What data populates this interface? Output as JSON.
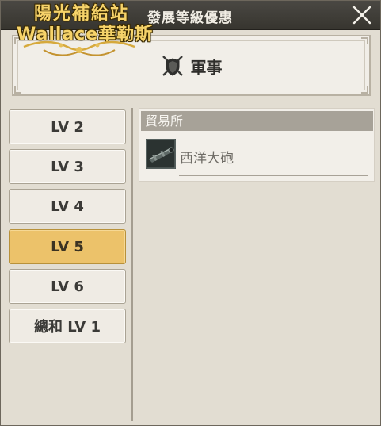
{
  "window": {
    "title": "發展等級優惠"
  },
  "watermark": {
    "line1": "陽光補給站",
    "line2": "Wallace華勒斯"
  },
  "header": {
    "category_label": "軍事",
    "category_icon": "crossed-swords-shield-icon"
  },
  "levels": [
    {
      "label": "LV 2",
      "active": false
    },
    {
      "label": "LV 3",
      "active": false
    },
    {
      "label": "LV 4",
      "active": false
    },
    {
      "label": "LV 5",
      "active": true
    },
    {
      "label": "LV 6",
      "active": false
    },
    {
      "label": "總和 LV 1",
      "active": false
    }
  ],
  "content": {
    "section_title": "貿易所",
    "items": [
      {
        "name": "西洋大砲",
        "icon": "cannon-icon"
      }
    ]
  },
  "colors": {
    "active_level": "#ecc26a",
    "section_header": "#a7a298",
    "titlebar": "#3d3b36"
  }
}
